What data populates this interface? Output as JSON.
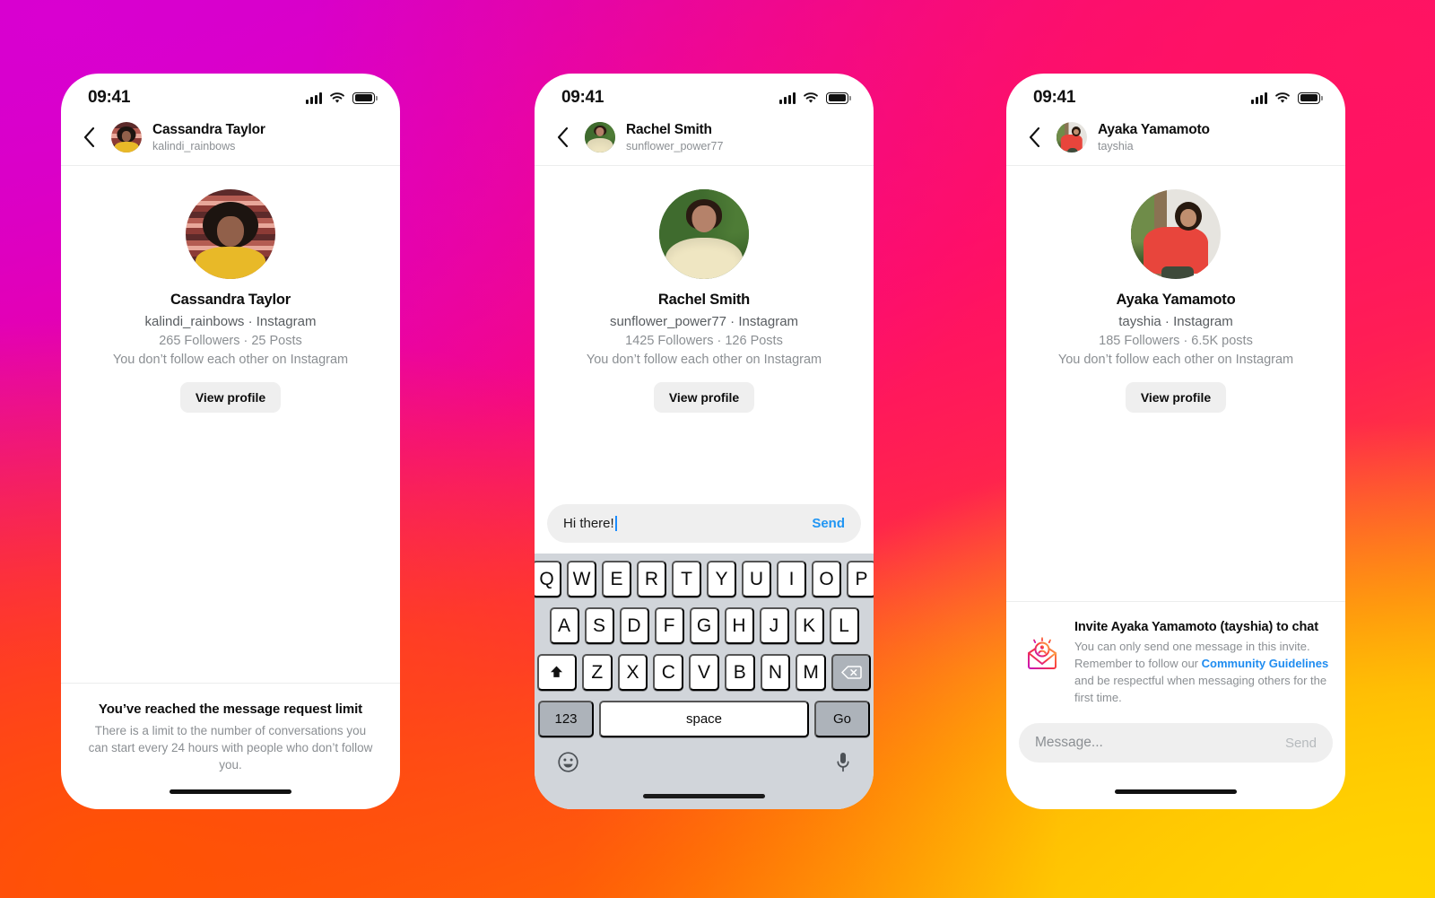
{
  "background": {
    "gradient_colors": [
      "#c800c8",
      "#ef0095",
      "#ff0a6b",
      "#ff2a45",
      "#ff6a10",
      "#ffc400"
    ],
    "accent_blue": "#2196f3",
    "link_blue": "#1f8cf0"
  },
  "shared": {
    "status_time": "09:41",
    "icons": {
      "signal": "signal-bars-icon",
      "wifi": "wifi-icon",
      "battery": "battery-icon",
      "back": "chevron-left-icon",
      "home": "home-indicator"
    },
    "relationship_text": "You don’t follow each other on Instagram",
    "view_profile_label": "View profile",
    "instagram_label": "Instagram"
  },
  "phones": [
    {
      "id": "phone-message-request-limit",
      "nav": {
        "name": "Cassandra Taylor",
        "username": "kalindi_rainbows"
      },
      "profile": {
        "name": "Cassandra Taylor",
        "subtitle": "kalindi_rainbows · Instagram",
        "stats": "265 Followers · 25 Posts",
        "relationship": "You don’t follow each other on Instagram",
        "view_profile_label": "View profile"
      },
      "footer_notice": {
        "title": "You’ve reached the message request limit",
        "body": "There is a limit to the number of conversations you can start every 24 hours with people who don’t follow you."
      }
    },
    {
      "id": "phone-composing-message",
      "nav": {
        "name": "Rachel Smith",
        "username": "sunflower_power77"
      },
      "profile": {
        "name": "Rachel Smith",
        "subtitle": "sunflower_power77 · Instagram",
        "stats": "1425 Followers · 126 Posts",
        "relationship": "You don’t follow each other on Instagram",
        "view_profile_label": "View profile"
      },
      "composer": {
        "value": "Hi there!",
        "send_label": "Send",
        "send_state": "active"
      },
      "keyboard": {
        "row1": [
          "Q",
          "W",
          "E",
          "R",
          "T",
          "Y",
          "U",
          "I",
          "O",
          "P"
        ],
        "row2": [
          "A",
          "S",
          "D",
          "F",
          "G",
          "H",
          "J",
          "K",
          "L"
        ],
        "row3": [
          "Z",
          "X",
          "C",
          "V",
          "B",
          "N",
          "M"
        ],
        "shift_label": "shift-icon",
        "backspace_label": "backspace-icon",
        "numbers_label": "123",
        "space_label": "space",
        "return_label": "Go",
        "emoji_label": "emoji-icon",
        "dictation_label": "microphone-icon"
      }
    },
    {
      "id": "phone-chat-invite",
      "nav": {
        "name": "Ayaka Yamamoto",
        "username": "tayshia"
      },
      "profile": {
        "name": "Ayaka Yamamoto",
        "subtitle": "tayshia · Instagram",
        "stats": "185 Followers · 6.5K posts",
        "relationship": "You don’t follow each other on Instagram",
        "view_profile_label": "View profile"
      },
      "invite_notice": {
        "icon": "invite-envelope-icon",
        "title": "Invite Ayaka Yamamoto (tayshia) to chat",
        "body_part_1": "You can only send one message in this invite. Remember to follow our ",
        "link_label": "Community Guidelines",
        "body_part_2": " and be respectful when messaging others for the first time."
      },
      "composer": {
        "placeholder": "Message...",
        "send_label": "Send",
        "send_state": "disabled"
      }
    }
  ]
}
